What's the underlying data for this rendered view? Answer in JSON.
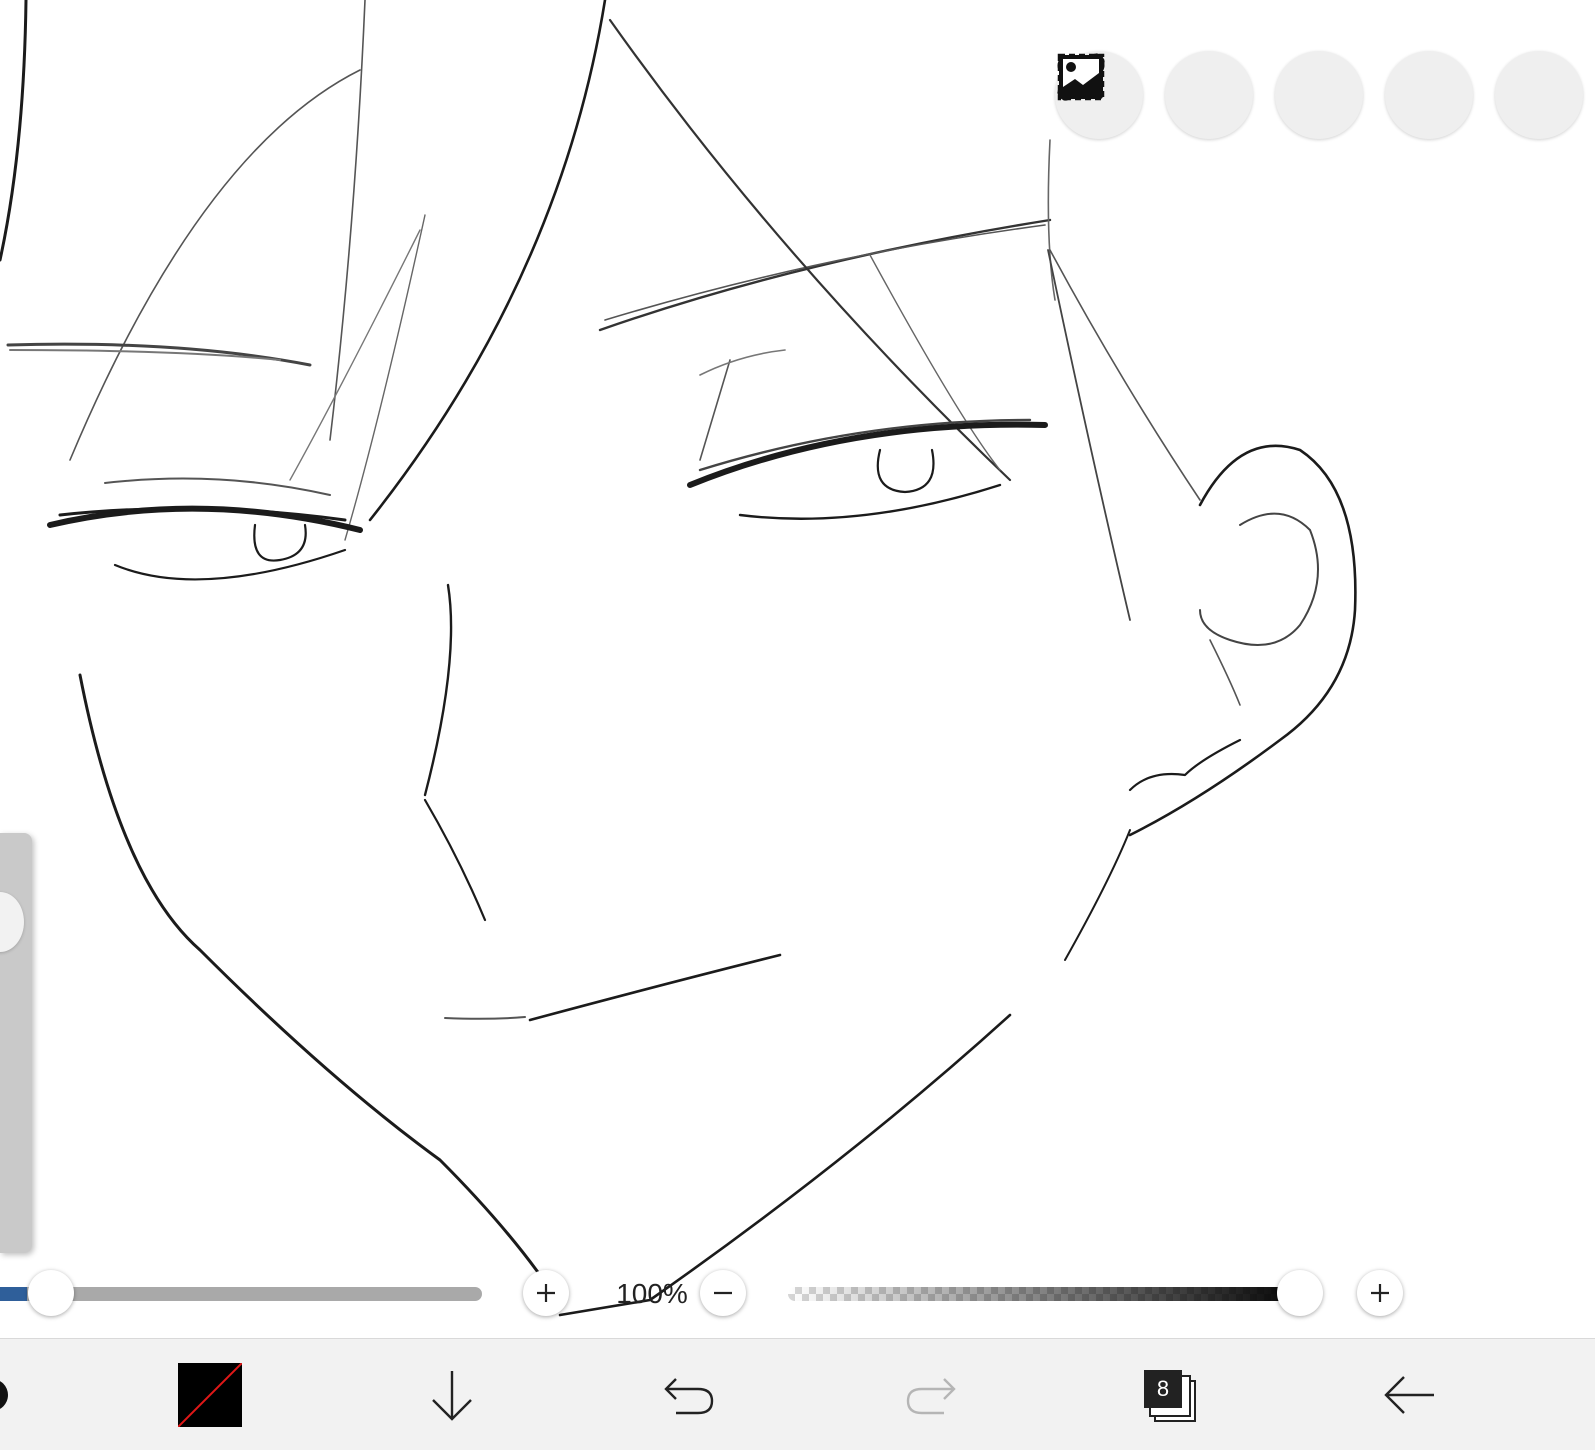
{
  "top_tools": [
    {
      "name": "toggle-icon"
    },
    {
      "name": "selection-icon"
    },
    {
      "name": "hand-icon"
    },
    {
      "name": "ruler-icon"
    },
    {
      "name": "image-icon"
    }
  ],
  "brush": {
    "size_fraction": 0.055,
    "opacity_fraction": 0.98,
    "zoom_label": "100%"
  },
  "colors": {
    "primary": "#000000",
    "slash": "#e01818",
    "accent": "#2f5f9a"
  },
  "bottom_bar": {
    "layer_count": "8",
    "items": [
      "brush-icon",
      "color-swatch",
      "arrow-down-icon",
      "undo-icon",
      "redo-icon",
      "layers-icon",
      "back-icon"
    ]
  }
}
